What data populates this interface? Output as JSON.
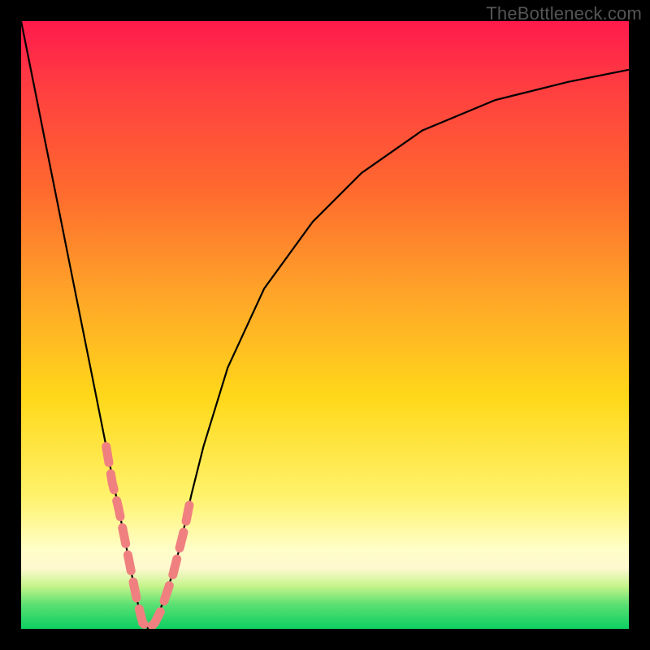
{
  "watermark": "TheBottleneck.com",
  "chart_data": {
    "type": "line",
    "title": "",
    "xlabel": "",
    "ylabel": "",
    "xlim": [
      0,
      100
    ],
    "ylim": [
      0,
      100
    ],
    "background_gradient": {
      "direction": "top-to-bottom",
      "stops": [
        {
          "pct": 0,
          "color": "#ff1a4c",
          "meaning": "high-bottleneck"
        },
        {
          "pct": 28,
          "color": "#ff6a2e"
        },
        {
          "pct": 62,
          "color": "#ffd81a"
        },
        {
          "pct": 87,
          "color": "#fffec8"
        },
        {
          "pct": 100,
          "color": "#0dcf62",
          "meaning": "no-bottleneck"
        }
      ]
    },
    "series": [
      {
        "name": "bottleneck-curve",
        "style": "solid-black",
        "x": [
          0,
          2,
          4,
          6,
          8,
          10,
          12,
          14,
          16,
          18,
          19,
          20,
          21,
          22,
          24,
          26,
          28,
          30,
          34,
          40,
          48,
          56,
          66,
          78,
          90,
          100
        ],
        "y": [
          100,
          90,
          80,
          70,
          60,
          50,
          40,
          30,
          20,
          10,
          5,
          1,
          0,
          1,
          6,
          13,
          22,
          30,
          43,
          56,
          67,
          75,
          82,
          87,
          90,
          92
        ]
      },
      {
        "name": "highlight-near-minimum",
        "style": "dashed-pink",
        "note": "Short dashed segments traced over the curve in the low (green/yellow) zone, both branches around the minimum.",
        "x": [
          14,
          15,
          16,
          17,
          18,
          19,
          20,
          21,
          22,
          23,
          24,
          25,
          26,
          27,
          28
        ],
        "y": [
          30,
          24,
          20,
          15,
          10,
          5,
          1,
          0,
          1,
          3,
          6,
          9,
          13,
          17,
          22
        ]
      }
    ],
    "minimum": {
      "x": 21,
      "y": 0
    }
  }
}
